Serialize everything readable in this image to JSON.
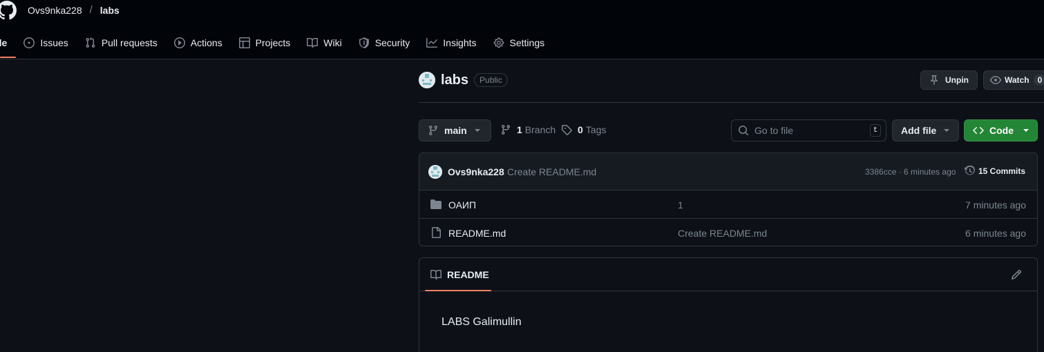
{
  "header": {
    "owner": "Ovs9nka228",
    "separator": "/",
    "repo": "labs"
  },
  "nav": {
    "code": "de",
    "issues": "Issues",
    "pull_requests": "Pull requests",
    "actions": "Actions",
    "projects": "Projects",
    "wiki": "Wiki",
    "security": "Security",
    "insights": "Insights",
    "settings": "Settings"
  },
  "repo": {
    "name": "labs",
    "visibility": "Public",
    "unpin_label": "Unpin",
    "watch_label": "Watch",
    "watch_count": "0"
  },
  "toolbar": {
    "branch": "main",
    "branch_count": "1",
    "branch_label": "Branch",
    "tag_count": "0",
    "tag_label": "Tags",
    "search_placeholder": "Go to file",
    "search_shortcut": "t",
    "add_file_label": "Add file",
    "code_label": "Code"
  },
  "latest_commit": {
    "author": "Ovs9nka228",
    "message": "Create README.md",
    "meta": "3386cce · 6 minutes ago",
    "commits_count": "15 Commits"
  },
  "files": [
    {
      "type": "folder",
      "name": "ОАИП",
      "commit": "1",
      "age": "7 minutes ago"
    },
    {
      "type": "file",
      "name": "README.md",
      "commit": "Create README.md",
      "age": "6 minutes ago"
    }
  ],
  "readme": {
    "tab_label": "README",
    "content": "LABS Galimullin"
  },
  "colors": {
    "background": "#0d1117",
    "header_bg": "#010409",
    "border": "#30363d",
    "accent_underline": "#f78166",
    "code_button": "#238636",
    "muted_text": "#7d8590"
  },
  "icons": {
    "logo": "github-mark-icon",
    "issues": "issue-opened-icon",
    "pull_requests": "git-pull-request-icon",
    "actions": "play-icon",
    "projects": "table-icon",
    "wiki": "book-icon",
    "security": "shield-icon",
    "insights": "graph-icon",
    "settings": "gear-icon"
  }
}
